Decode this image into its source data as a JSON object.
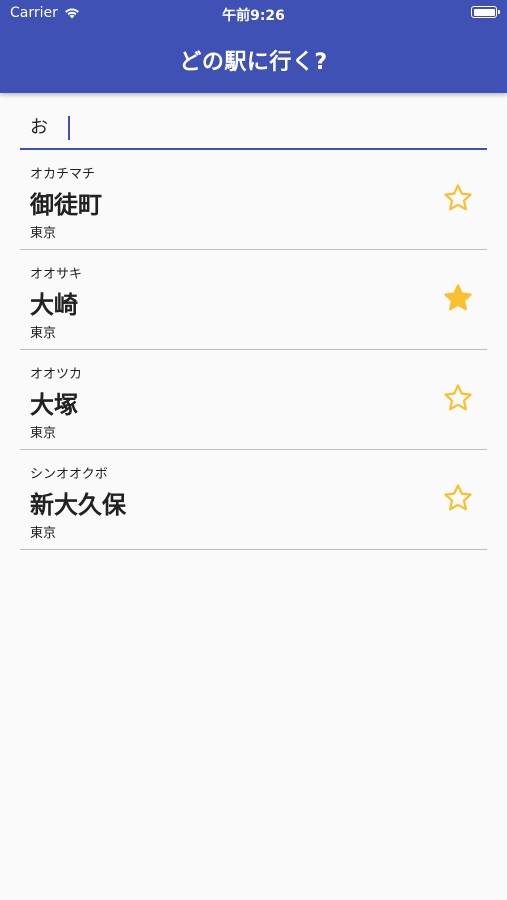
{
  "status_bar": {
    "carrier": "Carrier",
    "time": "午前9:26"
  },
  "header": {
    "title": "どの駅に行く?"
  },
  "search": {
    "value": "お"
  },
  "colors": {
    "app_bar": "#3f51b5",
    "star": "#fbc02d"
  },
  "stations": [
    {
      "kana": "オカチマチ",
      "name": "御徒町",
      "area": "東京",
      "favorite": false
    },
    {
      "kana": "オオサキ",
      "name": "大崎",
      "area": "東京",
      "favorite": true
    },
    {
      "kana": "オオツカ",
      "name": "大塚",
      "area": "東京",
      "favorite": false
    },
    {
      "kana": "シンオオクボ",
      "name": "新大久保",
      "area": "東京",
      "favorite": false
    }
  ]
}
